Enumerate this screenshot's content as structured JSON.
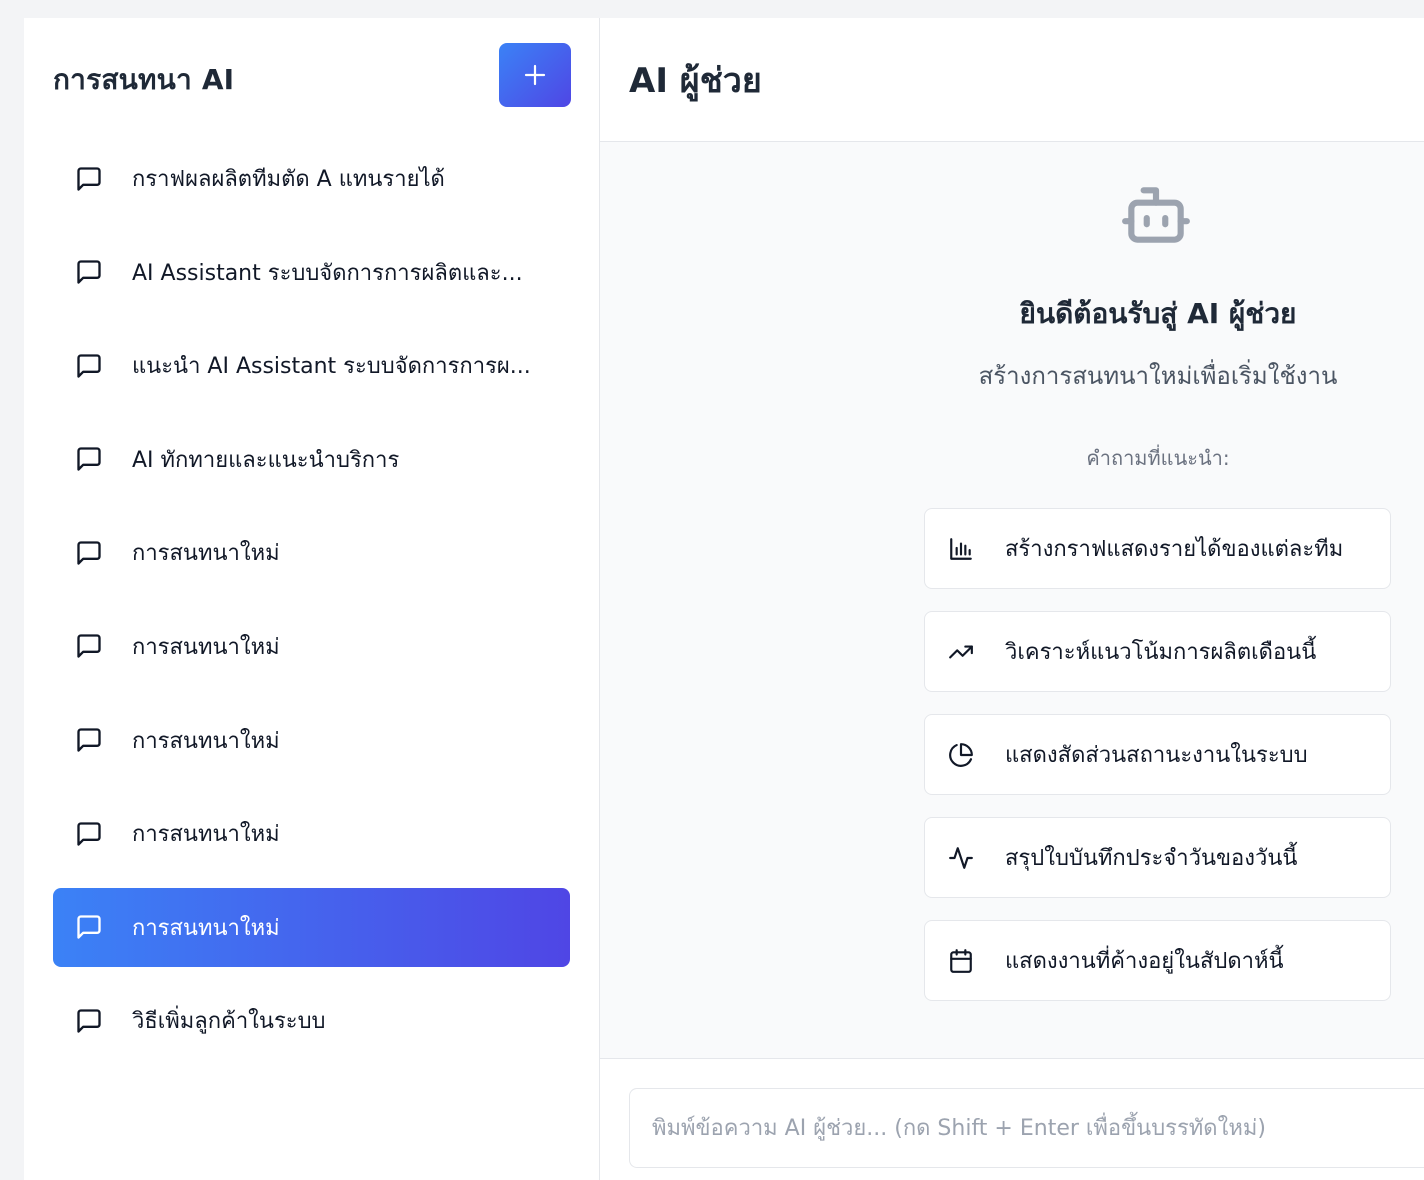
{
  "sidebar": {
    "title": "การสนทนา AI",
    "new_button_icon": "plus-icon",
    "items": [
      {
        "label": "กราฟผลผลิตทีมตัด A แทนรายได้",
        "icon": "message-square-icon",
        "active": false
      },
      {
        "label": "AI Assistant ระบบจัดการการผลิตและ...",
        "icon": "message-square-icon",
        "active": false
      },
      {
        "label": "แนะนำ AI Assistant ระบบจัดการการผ...",
        "icon": "message-square-icon",
        "active": false
      },
      {
        "label": "AI ทักทายและแนะนำบริการ",
        "icon": "message-square-icon",
        "active": false
      },
      {
        "label": "การสนทนาใหม่",
        "icon": "message-square-icon",
        "active": false
      },
      {
        "label": "การสนทนาใหม่",
        "icon": "message-square-icon",
        "active": false
      },
      {
        "label": "การสนทนาใหม่",
        "icon": "message-square-icon",
        "active": false
      },
      {
        "label": "การสนทนาใหม่",
        "icon": "message-square-icon",
        "active": false
      },
      {
        "label": "การสนทนาใหม่",
        "icon": "message-square-icon",
        "active": true
      },
      {
        "label": "วิธีเพิ่มลูกค้าในระบบ",
        "icon": "message-square-icon",
        "active": false
      }
    ]
  },
  "main": {
    "title": "AI ผู้ช่วย",
    "welcome": {
      "icon": "bot-icon",
      "title": "ยินดีต้อนรับสู่ AI ผู้ช่วย",
      "subtitle": "สร้างการสนทนาใหม่เพื่อเริ่มใช้งาน",
      "suggest_heading": "คำถามที่แนะนำ:",
      "suggestions": [
        {
          "label": "สร้างกราฟแสดงรายได้ของแต่ละทีม",
          "icon": "bar-chart-icon"
        },
        {
          "label": "วิเคราะห์แนวโน้มการผลิตเดือนนี้",
          "icon": "trending-up-icon"
        },
        {
          "label": "แสดงสัดส่วนสถานะงานในระบบ",
          "icon": "pie-chart-icon"
        },
        {
          "label": "สรุปใบบันทึกประจำวันของวันนี้",
          "icon": "activity-icon"
        },
        {
          "label": "แสดงงานที่ค้างอยู่ในสัปดาห์นี้",
          "icon": "calendar-icon"
        }
      ]
    },
    "input": {
      "placeholder": "พิมพ์ข้อความ AI ผู้ช่วย... (กด Shift + Enter เพื่อขึ้นบรรทัดใหม่)",
      "value": ""
    }
  },
  "colors": {
    "accent_start": "#3b82f6",
    "accent_end": "#4f46e5",
    "bot_icon": "#9ca3af"
  }
}
